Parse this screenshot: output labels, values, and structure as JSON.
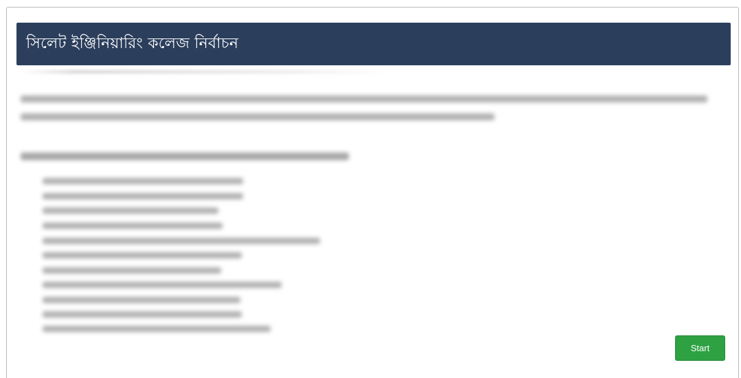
{
  "page": {
    "title": "সিলেট ইঞ্জিনিয়ারিং কলেজ নির্বাচন"
  },
  "content": {
    "blurred_text_note": "",
    "start_label": "Start"
  },
  "colors": {
    "header_background": "#2b3e5c",
    "header_text": "#ffffff",
    "start_button": "#2ea243"
  }
}
